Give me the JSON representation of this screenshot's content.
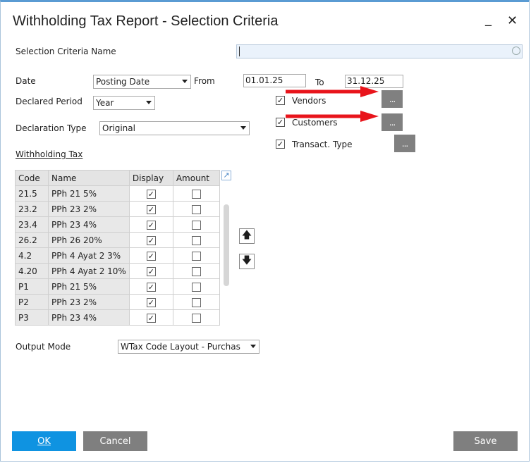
{
  "window": {
    "title": "Withholding Tax Report - Selection Criteria",
    "minimize": "_",
    "close": "✕"
  },
  "criteria_name": {
    "label": "Selection Criteria Name",
    "value": ""
  },
  "date": {
    "label": "Date",
    "type": "Posting Date",
    "from_label": "From",
    "from": "01.01.25",
    "to_label": "To",
    "to": "31.12.25"
  },
  "declared_period": {
    "label": "Declared Period",
    "value": "Year"
  },
  "declaration_type": {
    "label": "Declaration Type",
    "value": "Original"
  },
  "filters": [
    {
      "label": "Vendors",
      "checked": true,
      "button": "..."
    },
    {
      "label": "Customers",
      "checked": true,
      "button": "..."
    },
    {
      "label": "Transact. Type",
      "checked": true,
      "button": "..."
    }
  ],
  "wtax": {
    "heading": "Withholding Tax",
    "columns": [
      "Code",
      "Name",
      "Display",
      "Amount"
    ],
    "rows": [
      {
        "code": "21.5",
        "name": "PPh 21 5%",
        "display": true,
        "amount": false
      },
      {
        "code": "23.2",
        "name": "PPh 23 2%",
        "display": true,
        "amount": false
      },
      {
        "code": "23.4",
        "name": "PPh 23 4%",
        "display": true,
        "amount": false
      },
      {
        "code": "26.2",
        "name": "PPh 26 20%",
        "display": true,
        "amount": false
      },
      {
        "code": "4.2",
        "name": "PPh 4 Ayat 2 3%",
        "display": true,
        "amount": false
      },
      {
        "code": "4.20",
        "name": "PPh 4 Ayat 2 10%",
        "display": true,
        "amount": false
      },
      {
        "code": "P1",
        "name": "PPh 21 5%",
        "display": true,
        "amount": false
      },
      {
        "code": "P2",
        "name": "PPh 23 2%",
        "display": true,
        "amount": false
      },
      {
        "code": "P3",
        "name": "PPh 23 4%",
        "display": true,
        "amount": false
      }
    ]
  },
  "output_mode": {
    "label": "Output Mode",
    "value": "WTax Code Layout - Purchas"
  },
  "buttons": {
    "ok": "OK",
    "cancel": "Cancel",
    "save": "Save"
  },
  "colors": {
    "ok": "#0f93e1",
    "gray_button": "#7f7f7f",
    "annotation_arrow": "#e8141b",
    "title_border": "#5a9bd3"
  }
}
